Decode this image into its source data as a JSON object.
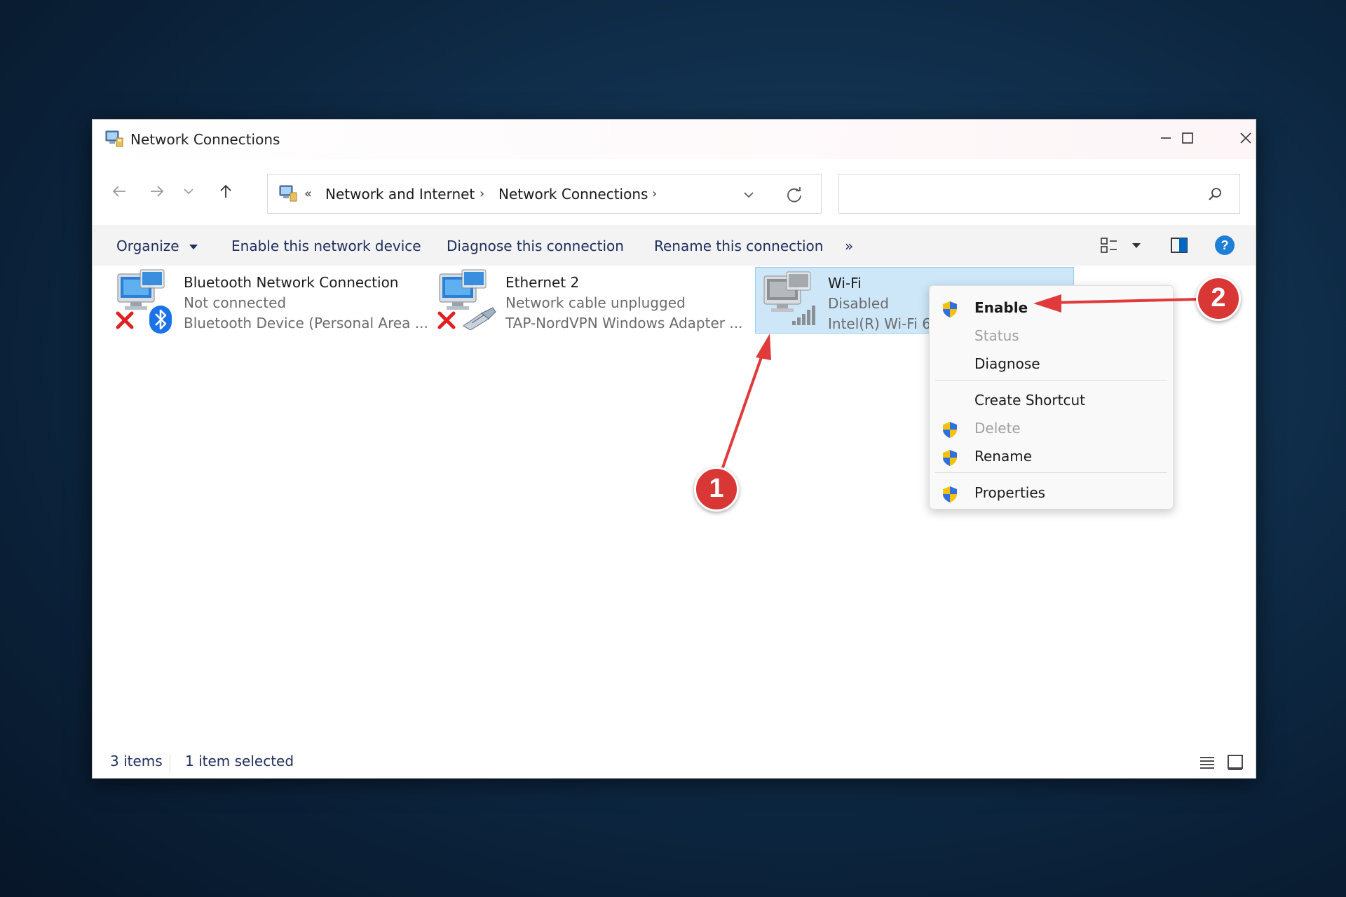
{
  "window": {
    "title": "Network Connections"
  },
  "address": {
    "prefix": "«",
    "crumbs": [
      "Network and Internet",
      "Network Connections"
    ],
    "separator": "›"
  },
  "search": {
    "placeholder": ""
  },
  "commands": {
    "organize": "Organize",
    "enable": "Enable this network device",
    "diagnose": "Diagnose this connection",
    "rename": "Rename this connection",
    "more": "»"
  },
  "items": [
    {
      "name": "Bluetooth Network Connection",
      "status": "Not connected",
      "device": "Bluetooth Device (Personal Area ..."
    },
    {
      "name": "Ethernet 2",
      "status": "Network cable unplugged",
      "device": "TAP-NordVPN Windows Adapter ..."
    },
    {
      "name": "Wi-Fi",
      "status": "Disabled",
      "device": "Intel(R) Wi-Fi 6"
    }
  ],
  "context_menu": {
    "enable": "Enable",
    "status": "Status",
    "diagnose": "Diagnose",
    "create_shortcut": "Create Shortcut",
    "delete": "Delete",
    "rename": "Rename",
    "properties": "Properties"
  },
  "statusbar": {
    "count": "3 items",
    "selected": "1 item selected"
  },
  "annotations": {
    "step1": "1",
    "step2": "2"
  },
  "colors": {
    "accent": "#0067c0",
    "selection": "#cde7f9",
    "annotation": "#d93636"
  }
}
